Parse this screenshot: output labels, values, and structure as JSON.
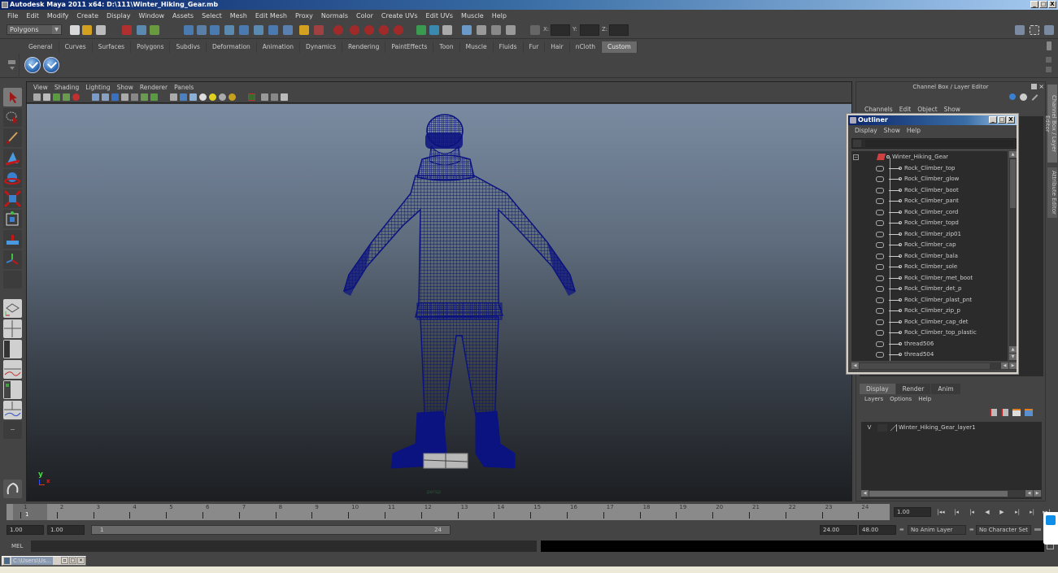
{
  "window": {
    "title": "Autodesk Maya 2011 x64: D:\\111\\Winter_Hiking_Gear.mb",
    "controls": [
      "_",
      "□",
      "X"
    ]
  },
  "menubar": [
    "File",
    "Edit",
    "Modify",
    "Create",
    "Display",
    "Window",
    "Assets",
    "Select",
    "Mesh",
    "Edit Mesh",
    "Proxy",
    "Normals",
    "Color",
    "Create UVs",
    "Edit UVs",
    "Muscle",
    "Help"
  ],
  "statusline": {
    "mode": "Polygons",
    "x_label": "X:",
    "y_label": "Y:",
    "z_label": "Z:",
    "x_value": "",
    "y_value": "",
    "z_value": ""
  },
  "shelf": {
    "tabs": [
      "General",
      "Curves",
      "Surfaces",
      "Polygons",
      "Subdivs",
      "Deformation",
      "Animation",
      "Dynamics",
      "Rendering",
      "PaintEffects",
      "Toon",
      "Muscle",
      "Fluids",
      "Fur",
      "Hair",
      "nCloth",
      "Custom"
    ],
    "active_tab": "Custom",
    "items": [
      "checkmark-icon",
      "checkmark-icon"
    ]
  },
  "toolbox": {
    "tools": [
      "select-tool",
      "lasso-tool",
      "paint-select-tool",
      "move-tool",
      "rotate-tool",
      "scale-tool",
      "universal-manipulator",
      "soft-mod-tool",
      "show-manipulator",
      "last-tool"
    ],
    "layouts": [
      "single-perspective",
      "four-view",
      "persp-outliner",
      "persp-graph",
      "hypershade-persp",
      "persp-graph-hypergraph",
      "custom-layout"
    ]
  },
  "viewport": {
    "menu": [
      "View",
      "Shading",
      "Lighting",
      "Show",
      "Renderer",
      "Panels"
    ],
    "camera": "persp",
    "axis": {
      "y": "y",
      "x": "x"
    },
    "colors": {
      "wireframe": "#0b1380",
      "bg_top": "#7a8ba1",
      "bg_bottom": "#1c1e21"
    }
  },
  "channel_box": {
    "title": "Channel Box / Layer Editor",
    "menu": [
      "Channels",
      "Edit",
      "Object",
      "Show"
    ]
  },
  "side_tabs": [
    "Channel Box / Layer Editor",
    "Attribute Editor"
  ],
  "outliner": {
    "title": "Outliner",
    "menu": [
      "Display",
      "Show",
      "Help"
    ],
    "filter_value": "",
    "root": "Winter_Hiking_Gear",
    "items": [
      "Rock_Climber_top",
      "Rock_Climber_glow",
      "Rock_Climber_boot",
      "Rock_Climber_pant",
      "Rock_Climber_cord",
      "Rock_Climber_topd",
      "Rock_Climber_zip01",
      "Rock_Climber_cap",
      "Rock_Climber_bala",
      "Rock_Climber_sole",
      "Rock_Climber_met_boot",
      "Rock_Climber_det_p",
      "Rock_Climber_plast_pnt",
      "Rock_Climber_zip_p",
      "Rock_Climber_cap_det",
      "Rock_Climber_top_plastic",
      "thread506",
      "thread504"
    ]
  },
  "layer_editor": {
    "tabs": [
      "Display",
      "Render",
      "Anim"
    ],
    "active_tab": "Display",
    "menu": [
      "Layers",
      "Options",
      "Help"
    ],
    "layers": [
      {
        "visible": "V",
        "name": "Winter_Hiking_Gear_layer1"
      }
    ]
  },
  "timeline": {
    "ticks": [
      "1",
      "2",
      "3",
      "4",
      "5",
      "6",
      "7",
      "8",
      "9",
      "10",
      "11",
      "12",
      "13",
      "14",
      "15",
      "16",
      "17",
      "18",
      "19",
      "20",
      "21",
      "22",
      "23",
      "24"
    ],
    "current_frame": "1",
    "current_time": "1.00",
    "playback_buttons": [
      "go-to-start",
      "step-back-key",
      "step-back-frame",
      "play-backward",
      "play-forward",
      "step-forward-frame",
      "step-forward-key",
      "go-to-end"
    ]
  },
  "range": {
    "start_time": "1.00",
    "playback_start": "1.00",
    "slider_start": "1",
    "slider_end": "24",
    "playback_end": "24.00",
    "end_time": "48.00",
    "anim_layer": "No Anim Layer",
    "character_set": "No Character Set"
  },
  "command_line": {
    "label": "MEL",
    "input": "",
    "output": ""
  },
  "taskbar": {
    "item_label": "C:\\Users\\Us..."
  }
}
